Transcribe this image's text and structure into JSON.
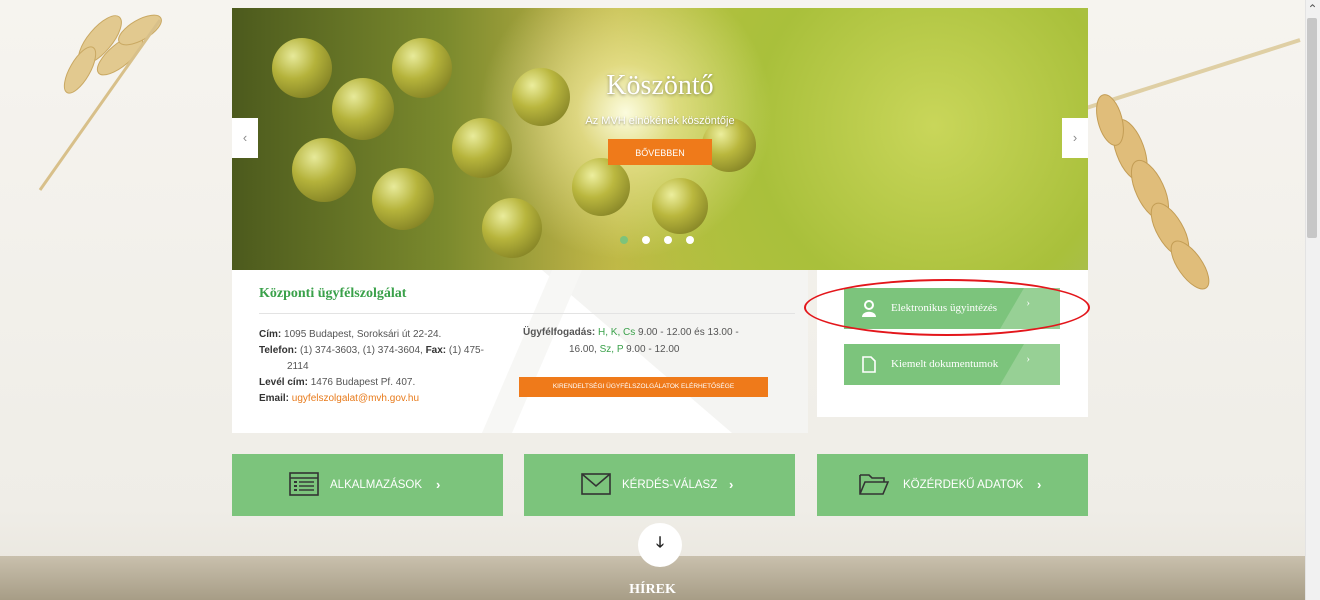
{
  "slider": {
    "title": "Köszöntő",
    "subtitle": "Az MVH elnökének köszöntője",
    "more_button": "BŐVEBBEN",
    "prev_arrow": "‹",
    "next_arrow": "›",
    "active_dot": 1,
    "dot_count": 4
  },
  "contact": {
    "heading": "Központi ügyfélszolgálat",
    "address_label": "Cím:",
    "address": "1095 Budapest, Soroksári út 22-24.",
    "phone_label": "Telefon:",
    "phone": "(1) 374-3603, (1) 374-3604,",
    "fax_label": "Fax:",
    "fax_part1": "(1) 475-",
    "fax_part2": "2114",
    "postal_label": "Levél cím:",
    "postal": "1476 Budapest Pf. 407.",
    "email_label": "Email:",
    "email": "ugyfelszolgalat@mvh.gov.hu",
    "hours_label": "Ügyfélfogadás:",
    "hours_days1": "H, K, Cs",
    "hours_time1": "9.00 - 12.00 és 13.00 -",
    "hours_time1b": "16.00,",
    "hours_days2": "Sz, P",
    "hours_time2": "9.00 - 12.00",
    "offices_button": "KIRENDELTSÉGI ÜGYFÉLSZOLGÁLATOK ELÉRHETŐSÉGE"
  },
  "side": {
    "electronic_label": "Elektronikus ügyintézés",
    "documents_label": "Kiemelt dokumentumok",
    "chevron": "›"
  },
  "tiles": {
    "apps": "ALKALMAZÁSOK",
    "qa": "KÉRDÉS-VÁLASZ",
    "public_data": "KÖZÉRDEKŰ ADATOK",
    "chevron": "›"
  },
  "news": {
    "title": "HÍREK",
    "arrow": "🡓"
  },
  "icons": [
    "chevron-left-icon",
    "chevron-right-icon",
    "user-icon",
    "document-icon",
    "list-icon",
    "envelope-icon",
    "folder-icon",
    "arrow-down-icon"
  ],
  "colors": {
    "green": "#7cc47c",
    "green_text": "#3aa14a",
    "orange": "#ef7a1a",
    "annotation_red": "#e3161b"
  }
}
